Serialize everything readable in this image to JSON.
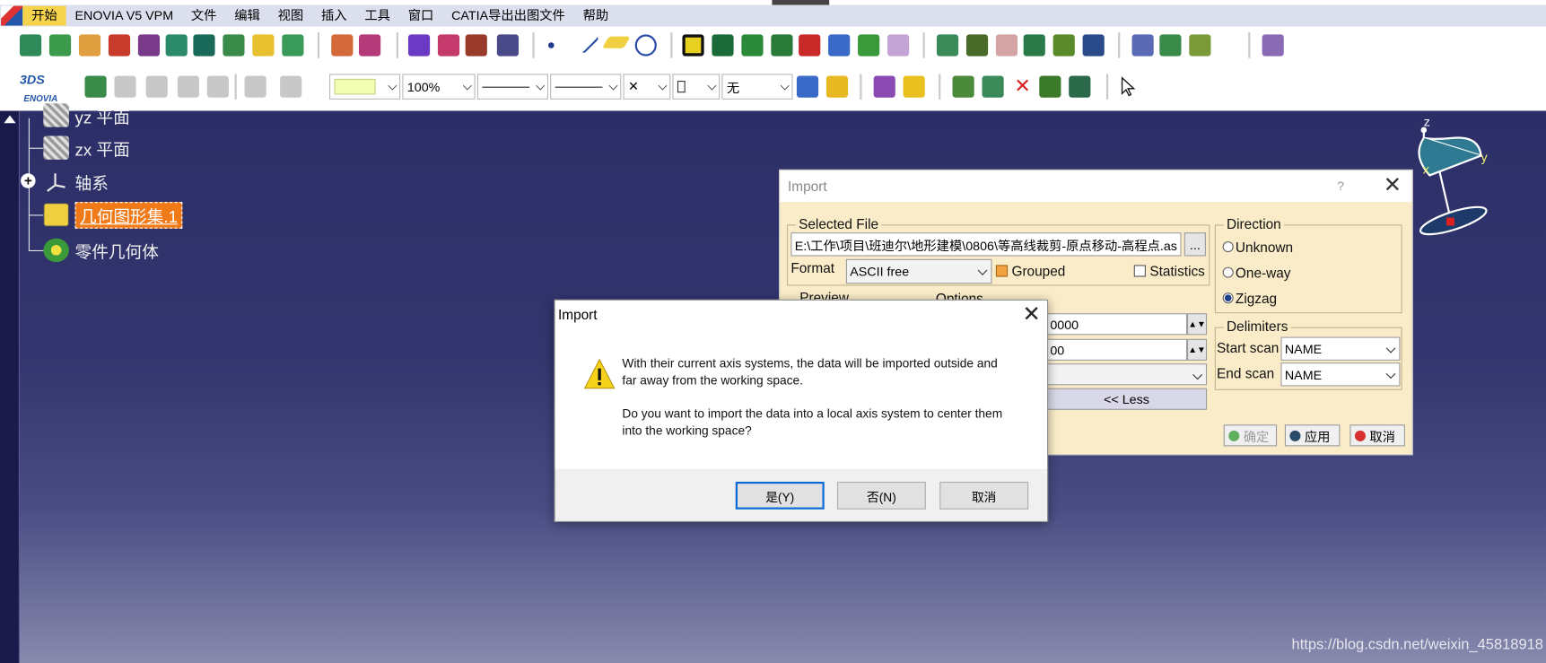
{
  "menubar": {
    "items": [
      "开始",
      "ENOVIA V5 VPM",
      "文件",
      "编辑",
      "视图",
      "插入",
      "工具",
      "窗口",
      "CATIA导出出图文件",
      "帮助"
    ]
  },
  "toolbar": {
    "zoom_value": "100%",
    "cross_symbol": "✕",
    "none_value": "无",
    "enovia_label": "ENOVIA",
    "ds_label": "3DS"
  },
  "tree": {
    "items": [
      {
        "label": "yz 平面"
      },
      {
        "label": "zx 平面"
      },
      {
        "label": "轴系"
      },
      {
        "label": "几何图形集.1",
        "selected": true
      },
      {
        "label": "零件几何体"
      }
    ]
  },
  "compass": {
    "x": "x",
    "y": "y",
    "z": "z"
  },
  "bg_dialog": {
    "title": "Import",
    "help": "?",
    "close": "✕",
    "selected_file_title": "Selected File",
    "file_path": "E:\\工作\\项目\\班迪尔\\地形建模\\0806\\等高线裁剪-原点移动-高程点.as",
    "browse": "...",
    "format_label": "Format",
    "format_value": "ASCII free",
    "grouped_label": "Grouped",
    "statistics_label": "Statistics",
    "preview_title": "Preview",
    "options_title": "Options",
    "field1": "0000",
    "field2": "00",
    "less_button": "<< Less",
    "direction_title": "Direction",
    "directions": [
      "Unknown",
      "One-way",
      "Zigzag"
    ],
    "direction_selected": "Zigzag",
    "delimiters_title": "Delimiters",
    "start_scan_label": "Start scan",
    "start_scan_value": "NAME",
    "end_scan_label": "End scan",
    "end_scan_value": "NAME",
    "ok_button": "确定",
    "apply_button": "应用",
    "cancel_button": "取消"
  },
  "modal": {
    "title": "Import",
    "close": "✕",
    "message_line1": "With their current axis systems, the data will be imported outside and",
    "message_line2": "far away  from the working space.",
    "message_line3": "Do you want to import the data into a local axis system to center them",
    "message_line4": "into  the working space?",
    "yes_button": "是(Y)",
    "no_button": "否(N)",
    "cancel_button": "取消"
  },
  "watermark": "https://blog.csdn.net/weixin_45818918",
  "colors": {
    "workspace_top": "#2c2e67",
    "workspace_bottom": "#8789ad",
    "menu_active": "#f5d34a",
    "dialog_bg": "#faecc8",
    "selected_tree": "#f07a18",
    "default_button_border": "#0a6ad6"
  }
}
